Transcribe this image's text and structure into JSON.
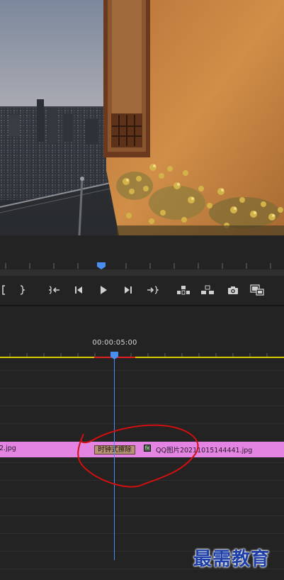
{
  "monitor": {
    "controls": [
      {
        "name": "mark-out-button",
        "icon": "bracket-close-icon"
      },
      {
        "name": "go-to-in-button",
        "icon": "go-to-in-icon"
      },
      {
        "name": "step-back-button",
        "icon": "step-back-icon"
      },
      {
        "name": "play-button",
        "icon": "play-icon"
      },
      {
        "name": "step-forward-button",
        "icon": "step-forward-icon"
      },
      {
        "name": "go-to-out-button",
        "icon": "go-to-out-icon"
      },
      {
        "name": "lift-button",
        "icon": "lift-icon"
      },
      {
        "name": "extract-button",
        "icon": "extract-icon"
      },
      {
        "name": "export-frame-button",
        "icon": "camera-icon"
      },
      {
        "name": "compare-view-button",
        "icon": "compare-icon"
      }
    ]
  },
  "timeline": {
    "timecode": "00:00:05:00",
    "clip_left_name": "2.jpg",
    "transition_label": "时钟式擦除",
    "fx_badge": "fx",
    "clip_right_name": "QQ图片20211015144441.jpg"
  },
  "watermark": "最需教育",
  "colors": {
    "clip": "#e384e3",
    "transition": "#b69276",
    "playhead": "#4a8df0",
    "work_area": "#d8cc00",
    "in_out_range": "#e02020",
    "annotation": "#d01010"
  }
}
